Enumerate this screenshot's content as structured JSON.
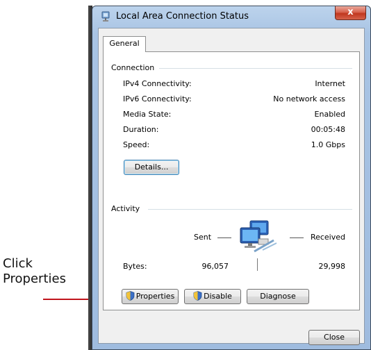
{
  "window": {
    "title": "Local Area Connection Status",
    "close_glyph": "x"
  },
  "tabs": [
    {
      "label": "General"
    }
  ],
  "connection": {
    "heading": "Connection",
    "rows": [
      {
        "label": "IPv4 Connectivity:",
        "value": "Internet"
      },
      {
        "label": "IPv6 Connectivity:",
        "value": "No network access"
      },
      {
        "label": "Media State:",
        "value": "Enabled"
      },
      {
        "label": "Duration:",
        "value": "00:05:48"
      },
      {
        "label": "Speed:",
        "value": "1.0 Gbps"
      }
    ],
    "details_button": "Details..."
  },
  "activity": {
    "heading": "Activity",
    "sent_label": "Sent",
    "received_label": "Received",
    "bytes_label": "Bytes:",
    "bytes_sent": "96,057",
    "bytes_received": "29,998"
  },
  "buttons": {
    "properties": "Properties",
    "disable": "Disable",
    "diagnose": "Diagnose",
    "close": "Close"
  },
  "annotation": {
    "line1": "Click",
    "line2": "Properties",
    "arrow_color": "#c0141c"
  },
  "icons": {
    "title": "network-connection-icon",
    "activity": "network-computers-icon",
    "shield": "uac-shield-icon"
  }
}
